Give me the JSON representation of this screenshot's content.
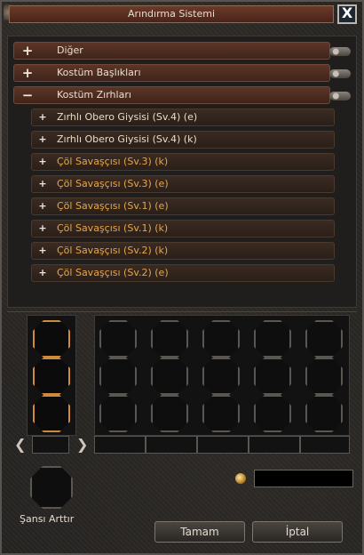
{
  "window": {
    "title": "Arındırma Sistemi",
    "close_label": "X"
  },
  "categories": [
    {
      "sign": "+",
      "label": "Diğer"
    },
    {
      "sign": "+",
      "label": "Kostüm Başlıkları"
    },
    {
      "sign": "−",
      "label": "Kostüm Zırhları"
    }
  ],
  "items": [
    {
      "sign": "+",
      "label": "Zırhlı Obero Giysisi (Sv.4) (e)",
      "color": "#e8dcc6"
    },
    {
      "sign": "+",
      "label": "Zırhlı Obero Giysisi (Sv.4) (k)",
      "color": "#e8dcc6"
    },
    {
      "sign": "+",
      "label": "Çöl Savaşçısı (Sv.3) (k)",
      "color": "#e6a64a"
    },
    {
      "sign": "+",
      "label": "Çöl Savaşçısı (Sv.3) (e)",
      "color": "#e6a64a"
    },
    {
      "sign": "+",
      "label": "Çöl Savaşçısı (Sv.1) (e)",
      "color": "#e6a64a"
    },
    {
      "sign": "+",
      "label": "Çöl Savaşçısı (Sv.1) (k)",
      "color": "#e6a64a"
    },
    {
      "sign": "+",
      "label": "Çöl Savaşçısı (Sv.2) (k)",
      "color": "#e6a64a"
    },
    {
      "sign": "+",
      "label": "Çöl Savaşçısı (Sv.2) (e)",
      "color": "#e6a64a"
    }
  ],
  "nav": {
    "prev": "❮",
    "next": "❯"
  },
  "chance": {
    "label": "Şansı Arttır"
  },
  "buttons": {
    "ok": "Tamam",
    "cancel": "İptal"
  }
}
